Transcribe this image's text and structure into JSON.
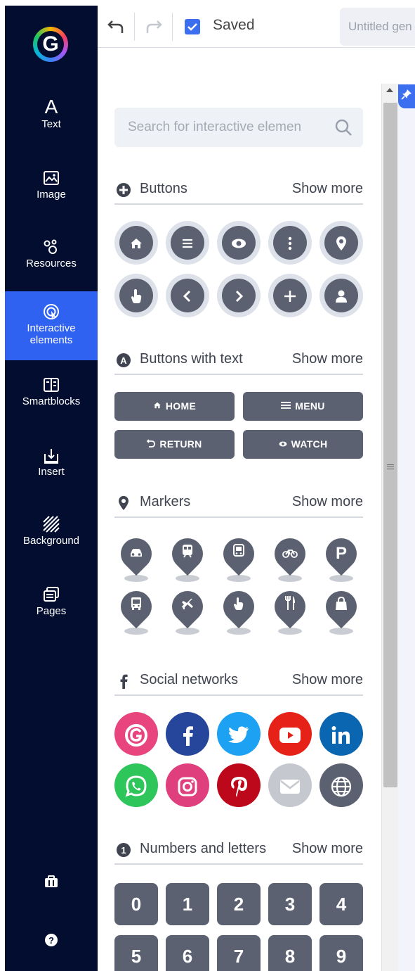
{
  "app": {
    "logo_letter": "G"
  },
  "nav": {
    "items": [
      {
        "label": "Text",
        "icon": "text-icon"
      },
      {
        "label": "Image",
        "icon": "image-icon"
      },
      {
        "label": "Resources",
        "icon": "resources-icon"
      },
      {
        "label": "Interactive elements",
        "label_line1": "Interactive",
        "label_line2": "elements",
        "icon": "interactive-icon",
        "active": true
      },
      {
        "label": "Smartblocks",
        "icon": "smartblocks-icon"
      },
      {
        "label": "Insert",
        "icon": "insert-icon"
      },
      {
        "label": "Background",
        "icon": "background-icon"
      },
      {
        "label": "Pages",
        "icon": "pages-icon"
      }
    ],
    "bottom": [
      {
        "icon": "toolbox-icon"
      },
      {
        "icon": "help-icon"
      }
    ],
    "active_color": "#2f62f0",
    "bg_color": "#020d2f"
  },
  "topbar": {
    "saved_label": "Saved",
    "title_value": "Untitled gen"
  },
  "panel": {
    "search_placeholder": "Search for interactive elemen",
    "sections": {
      "buttons": {
        "title": "Buttons",
        "more": "Show more",
        "icons": [
          "home-icon",
          "menu-icon",
          "eye-icon",
          "more-vertical-icon",
          "location-pin-icon",
          "hand-pointer-icon",
          "chevron-left-icon",
          "chevron-right-icon",
          "plus-icon",
          "user-icon"
        ]
      },
      "buttons_text": {
        "title": "Buttons with text",
        "more": "Show more",
        "buttons": [
          {
            "label": "HOME",
            "icon": "home-icon"
          },
          {
            "label": "MENU",
            "icon": "menu-icon"
          },
          {
            "label": "RETURN",
            "icon": "return-icon"
          },
          {
            "label": "WATCH",
            "icon": "eye-icon"
          }
        ]
      },
      "markers": {
        "title": "Markers",
        "more": "Show more",
        "icons": [
          "car-marker",
          "train-marker",
          "bus-front-marker",
          "bicycle-marker",
          "parking-marker",
          "bus-marker",
          "plane-marker",
          "hand-marker",
          "restaurant-marker",
          "shopping-bag-marker"
        ],
        "parking_letter": "P"
      },
      "social": {
        "title": "Social networks",
        "more": "Show more",
        "networks": [
          {
            "name": "genially",
            "color": "#e8457f"
          },
          {
            "name": "facebook",
            "color": "#25469a"
          },
          {
            "name": "twitter",
            "color": "#1da1f2"
          },
          {
            "name": "youtube",
            "color": "#e62117"
          },
          {
            "name": "linkedin",
            "color": "#0a66b0"
          },
          {
            "name": "whatsapp",
            "color": "#2ec55a"
          },
          {
            "name": "instagram",
            "color": "#e03f7e"
          },
          {
            "name": "pinterest",
            "color": "#bd081c"
          },
          {
            "name": "email",
            "color": "#c5c8cf"
          },
          {
            "name": "website",
            "color": "#5b6170"
          }
        ]
      },
      "numbers": {
        "title": "Numbers and letters",
        "more": "Show more",
        "digits": [
          "0",
          "1",
          "2",
          "3",
          "4",
          "5",
          "6",
          "7",
          "8",
          "9"
        ]
      }
    }
  }
}
